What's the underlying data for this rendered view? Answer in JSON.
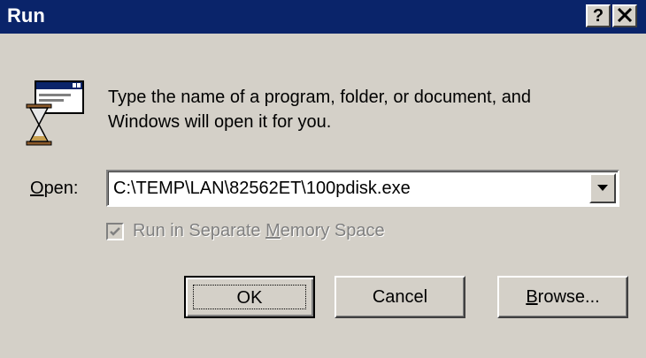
{
  "window": {
    "title": "Run",
    "help_glyph": "?",
    "close_icon": "close-icon"
  },
  "app_icon": "run-program-icon",
  "prompt": {
    "line1": "Type the name of a program, folder, or document, and",
    "line2": "Windows will open it for you."
  },
  "open": {
    "label_accel": "O",
    "label_rest": "pen:",
    "value": "C:\\TEMP\\LAN\\82562ET\\100pdisk.exe",
    "dropdown_icon": "chevron-down-icon"
  },
  "separate_memory": {
    "checked": true,
    "enabled": false,
    "label_before": "Run in Separate ",
    "label_accel": "M",
    "label_after": "emory Space"
  },
  "buttons": {
    "ok": "OK",
    "cancel": "Cancel",
    "browse_accel": "B",
    "browse_rest": "rowse..."
  },
  "colors": {
    "titlebar": "#0a246a",
    "face": "#d4d0c8",
    "disabled_text": "#808080"
  }
}
